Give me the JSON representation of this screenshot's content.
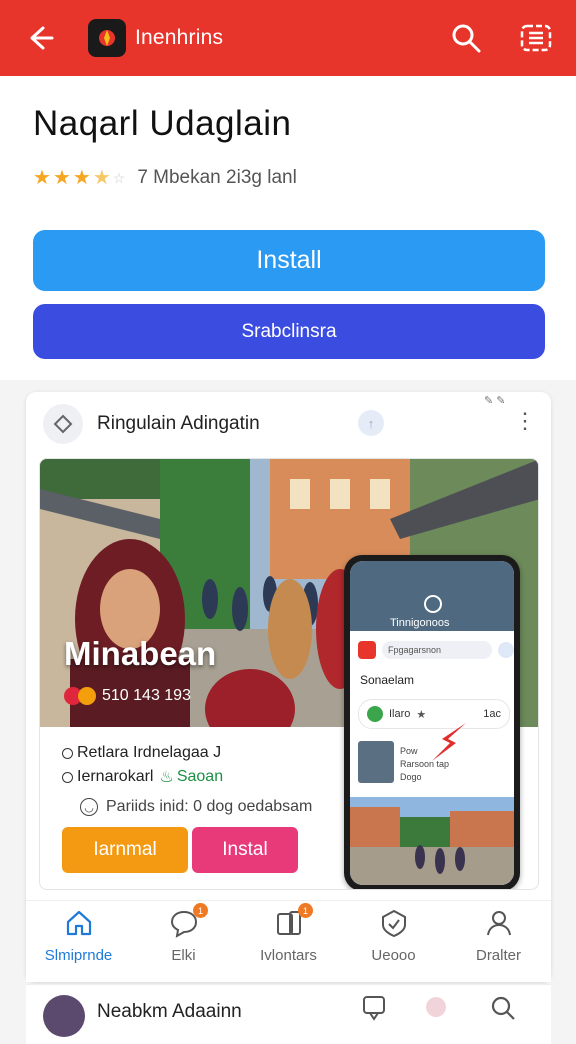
{
  "appbar": {
    "title": "Inenhrins",
    "back_icon": "arrow-left-icon",
    "search_icon": "search-icon",
    "menu_icon": "menu-box-icon"
  },
  "app": {
    "name": "Naqarl Udaglain",
    "rating_stars": 3.5,
    "rating_text": "7  Mbekan 2i3g lanl",
    "install_label": "Install",
    "second_label": "Srabclinsra"
  },
  "card": {
    "author": "Ringulain Adingatin",
    "promo": {
      "caption": "Minabean",
      "meta": "510 143 193",
      "line1": "Retlara Irdnelagaa J",
      "line2": "Iernarokarl",
      "line2_green": "Saoan",
      "line3": "Pariids inid: 0 dog oedabsam",
      "button_orange": "Iarnmal",
      "button_pink": "Instal"
    },
    "phone": {
      "top_text": "Tinnigonoos",
      "search_placeholder": "Fpgagarsnon",
      "section": "Sonaelam",
      "row_text": "Ilaro",
      "row_value": "1ас",
      "list_line1": "Pow",
      "list_line2": "Rarsoon tap",
      "list_line3": "Dogo"
    }
  },
  "tabs": [
    {
      "label": "Slmiprnde",
      "icon": "home-icon",
      "active": true
    },
    {
      "label": "Elki",
      "icon": "chat-icon",
      "badge": "1"
    },
    {
      "label": "Ivlontars",
      "icon": "phone-icon",
      "badge": "1"
    },
    {
      "label": "Ueooo",
      "icon": "shield-icon"
    },
    {
      "label": "Dralter",
      "icon": "profile-icon"
    }
  ],
  "next_post": {
    "author": "Neabkm Adaainn"
  },
  "colors": {
    "appbar": "#e8352b",
    "install": "#2b9af3",
    "secondary": "#3b4ce0",
    "orange": "#f39a12",
    "pink": "#e83a78",
    "active_tab": "#1f7ad6"
  }
}
